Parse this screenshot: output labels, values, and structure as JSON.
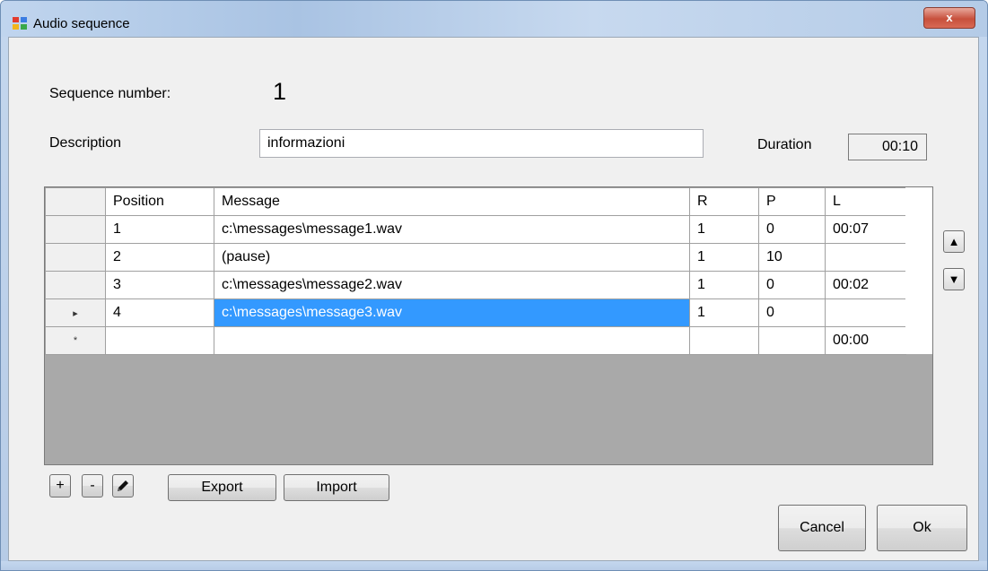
{
  "window": {
    "title": "Audio sequence",
    "close_glyph": "x"
  },
  "form": {
    "sequence_label": "Sequence number:",
    "sequence_value": "1",
    "description_label": "Description",
    "description_value": "informazioni",
    "duration_label": "Duration",
    "duration_value": "00:10"
  },
  "grid": {
    "columns": [
      "Position",
      "Message",
      "R",
      "P",
      "L"
    ],
    "rows": [
      {
        "marker": "",
        "position": "1",
        "message": "c:\\messages\\message1.wav",
        "r": "1",
        "p": "0",
        "l": "00:07"
      },
      {
        "marker": "",
        "position": "2",
        "message": "(pause)",
        "r": "1",
        "p": "10",
        "l": ""
      },
      {
        "marker": "",
        "position": "3",
        "message": "c:\\messages\\message2.wav",
        "r": "1",
        "p": "0",
        "l": "00:02"
      },
      {
        "marker": "▸",
        "position": "4",
        "message": "c:\\messages\\message3.wav",
        "r": "1",
        "p": "0",
        "l": ""
      },
      {
        "marker": "*",
        "position": "",
        "message": "",
        "r": "",
        "p": "",
        "l": "00:00"
      }
    ],
    "selected_row_index": 3
  },
  "side_buttons": {
    "up_icon": "arrow-up-icon",
    "down_icon": "arrow-down-icon",
    "up_glyph": "▲",
    "down_glyph": "▼"
  },
  "toolbar": {
    "add_label": "+",
    "remove_label": "-",
    "edit_icon": "pencil-icon",
    "export_label": "Export",
    "import_label": "Import"
  },
  "footer": {
    "cancel_label": "Cancel",
    "ok_label": "Ok"
  },
  "colors": {
    "selection": "#3399ff",
    "grid_background": "#a9a9a9",
    "dialog_background": "#f0f0f0"
  }
}
